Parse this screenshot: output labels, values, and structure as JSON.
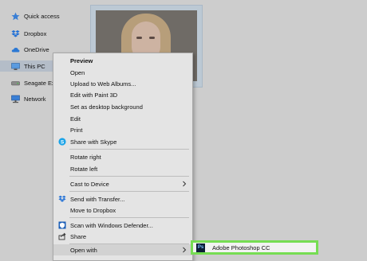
{
  "sidebar": {
    "items": [
      {
        "label": "Quick access",
        "icon": "star-icon"
      },
      {
        "label": "Dropbox",
        "icon": "dropbox-icon"
      },
      {
        "label": "OneDrive",
        "icon": "cloud-icon"
      },
      {
        "label": "This PC",
        "icon": "computer-icon"
      },
      {
        "label": "Seagate Ex",
        "icon": "drive-icon"
      },
      {
        "label": "Network",
        "icon": "network-icon"
      }
    ]
  },
  "context_menu": {
    "items": [
      {
        "label": "Preview"
      },
      {
        "label": "Open"
      },
      {
        "label": "Upload to Web Albums..."
      },
      {
        "label": "Edit with Paint 3D"
      },
      {
        "label": "Set as desktop background"
      },
      {
        "label": "Edit"
      },
      {
        "label": "Print"
      },
      {
        "label": "Share with Skype",
        "icon": "skype-icon"
      },
      {
        "label": "Rotate right"
      },
      {
        "label": "Rotate left"
      },
      {
        "label": "Cast to Device"
      },
      {
        "label": "Send with Transfer...",
        "icon": "dropbox-icon"
      },
      {
        "label": "Move to Dropbox"
      },
      {
        "label": "Scan with Windows Defender...",
        "icon": "defender-icon"
      },
      {
        "label": "Share",
        "icon": "share-icon"
      },
      {
        "label": "Open with"
      }
    ]
  },
  "submenu": {
    "items": [
      {
        "label": "Adobe Photoshop CC",
        "icon_text": "Ps"
      }
    ]
  },
  "colors": {
    "highlight_border": "#76dd53",
    "selected_nav": "#b4bdc8",
    "accent_blue": "#1f6fd6"
  }
}
